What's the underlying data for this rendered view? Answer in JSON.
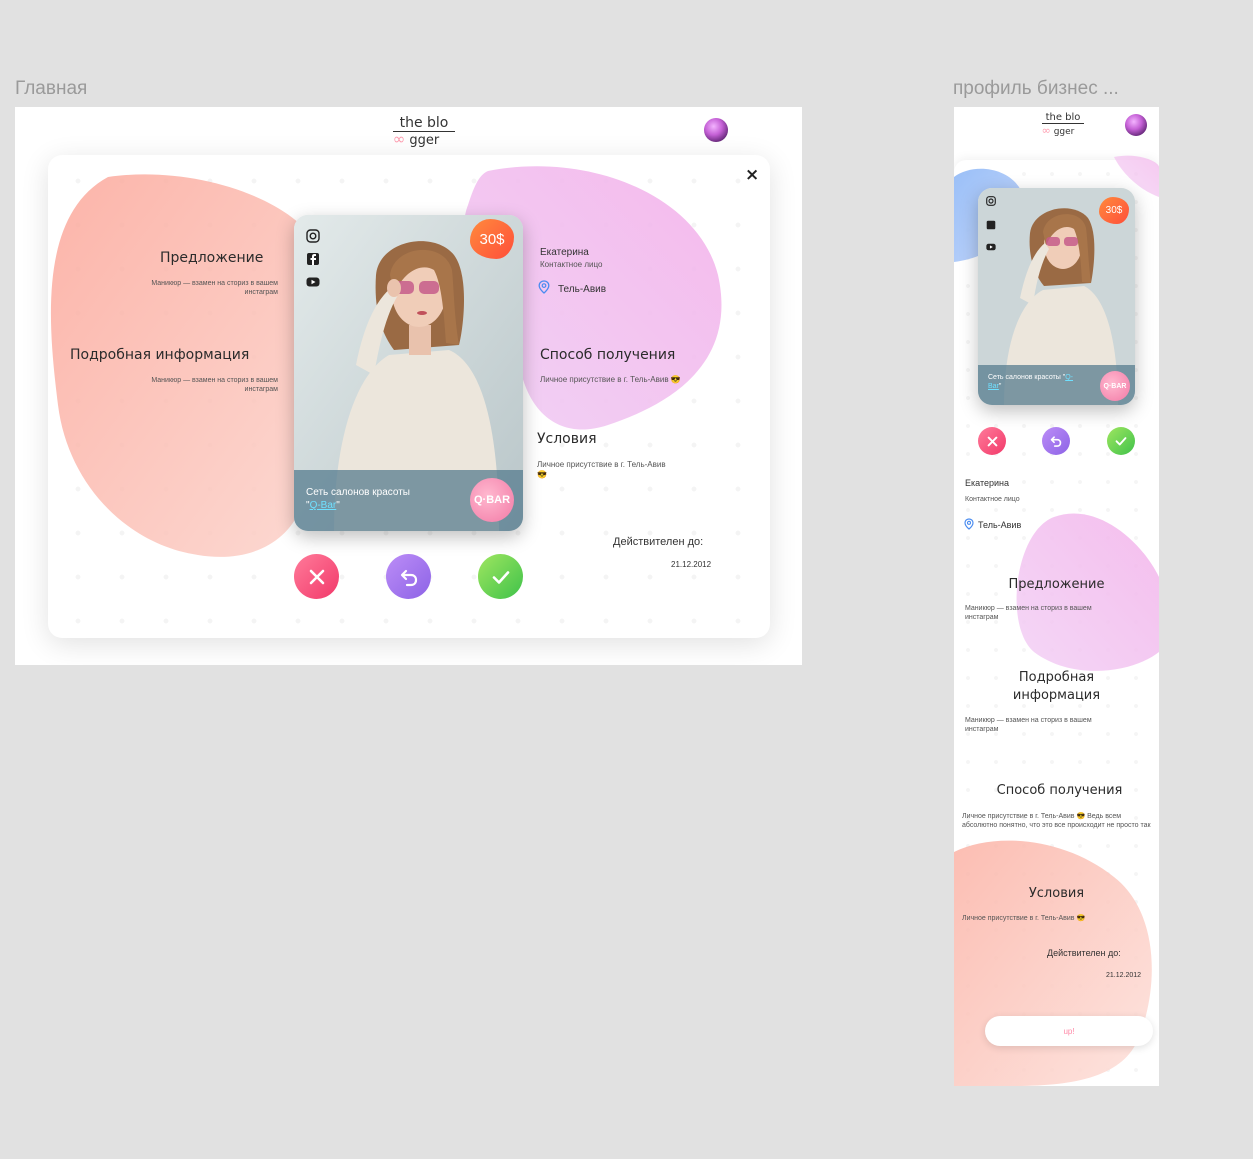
{
  "frames": {
    "desktop_title": "Главная",
    "mobile_title": "профиль бизнес ..."
  },
  "logo": {
    "line1": "the blo",
    "line2": "gger",
    "rings": "∞"
  },
  "offer": {
    "price": "30$",
    "card_caption_prefix": "Сеть салонов красоты \"",
    "card_caption_link": "Q-Bar",
    "card_caption_suffix": "\"",
    "qbar_badge": "Q·BAR",
    "social_icons": [
      "instagram-icon",
      "facebook-icon",
      "youtube-icon"
    ]
  },
  "desktop": {
    "offer_heading": "Предложение",
    "offer_text": "Маникюр — взамен на сториз в вашем инстаграм",
    "details_heading": "Подробная информация",
    "details_text": "Маникюр — взамен на сториз в вашем инстаграм",
    "contact_name": "Екатерина",
    "contact_role": "Контактное лицо",
    "location": "Тель-Авив",
    "receive_heading": "Способ получения",
    "receive_text": "Личное присутствие в г. Тель-Авив 😎",
    "conditions_heading": "Условия",
    "conditions_text": "Личное присутствие в г. Тель-Авив 😎",
    "valid_label": "Действителен до:",
    "valid_date": "21.12.2012",
    "close_label": "×"
  },
  "mobile": {
    "contact_name": "Екатерина",
    "contact_role": "Контактное лицо",
    "location": "Тель-Авив",
    "offer_heading": "Предложение",
    "offer_text": "Маникюр — взамен на сториз в вашем инстаграм",
    "details_heading": "Подробная информация",
    "details_text": "Маникюр — взамен на сториз в вашем инстаграм",
    "receive_heading": "Способ получения",
    "receive_text": "Личное присутствие в г. Тель-Авив 😎 Ведь всем абсолютно понятно, что это все происходит не просто так",
    "conditions_heading": "Условия",
    "conditions_text": "Личное присутствие в г. Тель-Авив 😎",
    "valid_label": "Действителен до:",
    "valid_date": "21.12.2012",
    "up_button": "up!"
  },
  "colors": {
    "reject": "#f2396a",
    "undo": "#8d63e6",
    "accept": "#3fc24a",
    "price": "#ff5b3a",
    "link": "#6fe0ff"
  }
}
